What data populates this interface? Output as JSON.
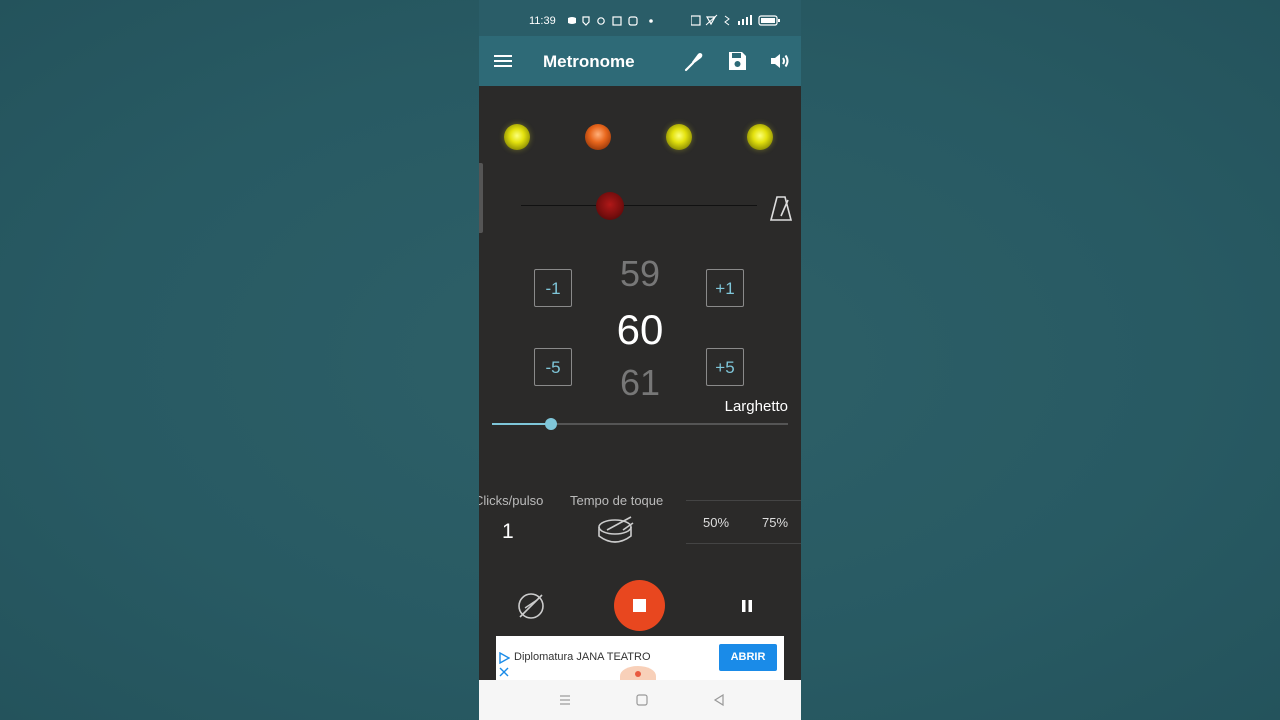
{
  "status": {
    "time": "11:39"
  },
  "appbar": {
    "title": "Metronome"
  },
  "bpm": {
    "previous": "59",
    "current": "60",
    "next": "61",
    "tempo_name": "Larghetto",
    "slider_fraction": 0.2
  },
  "steps": {
    "minus1": "-1",
    "plus1": "+1",
    "minus5": "-5",
    "plus5": "+5"
  },
  "settings": {
    "clicks_label": "Clicks/pulso",
    "clicks_value": "1",
    "tap_label": "Tempo de toque",
    "pct_50": "50%",
    "pct_75": "75%"
  },
  "ad": {
    "text": "Diplomatura JANA TEATRO",
    "button": "ABRIR"
  },
  "colors": {
    "accent": "#7fc6d9",
    "appbar": "#2e6a77",
    "stop": "#e8471f",
    "background": "#2b2a29"
  }
}
